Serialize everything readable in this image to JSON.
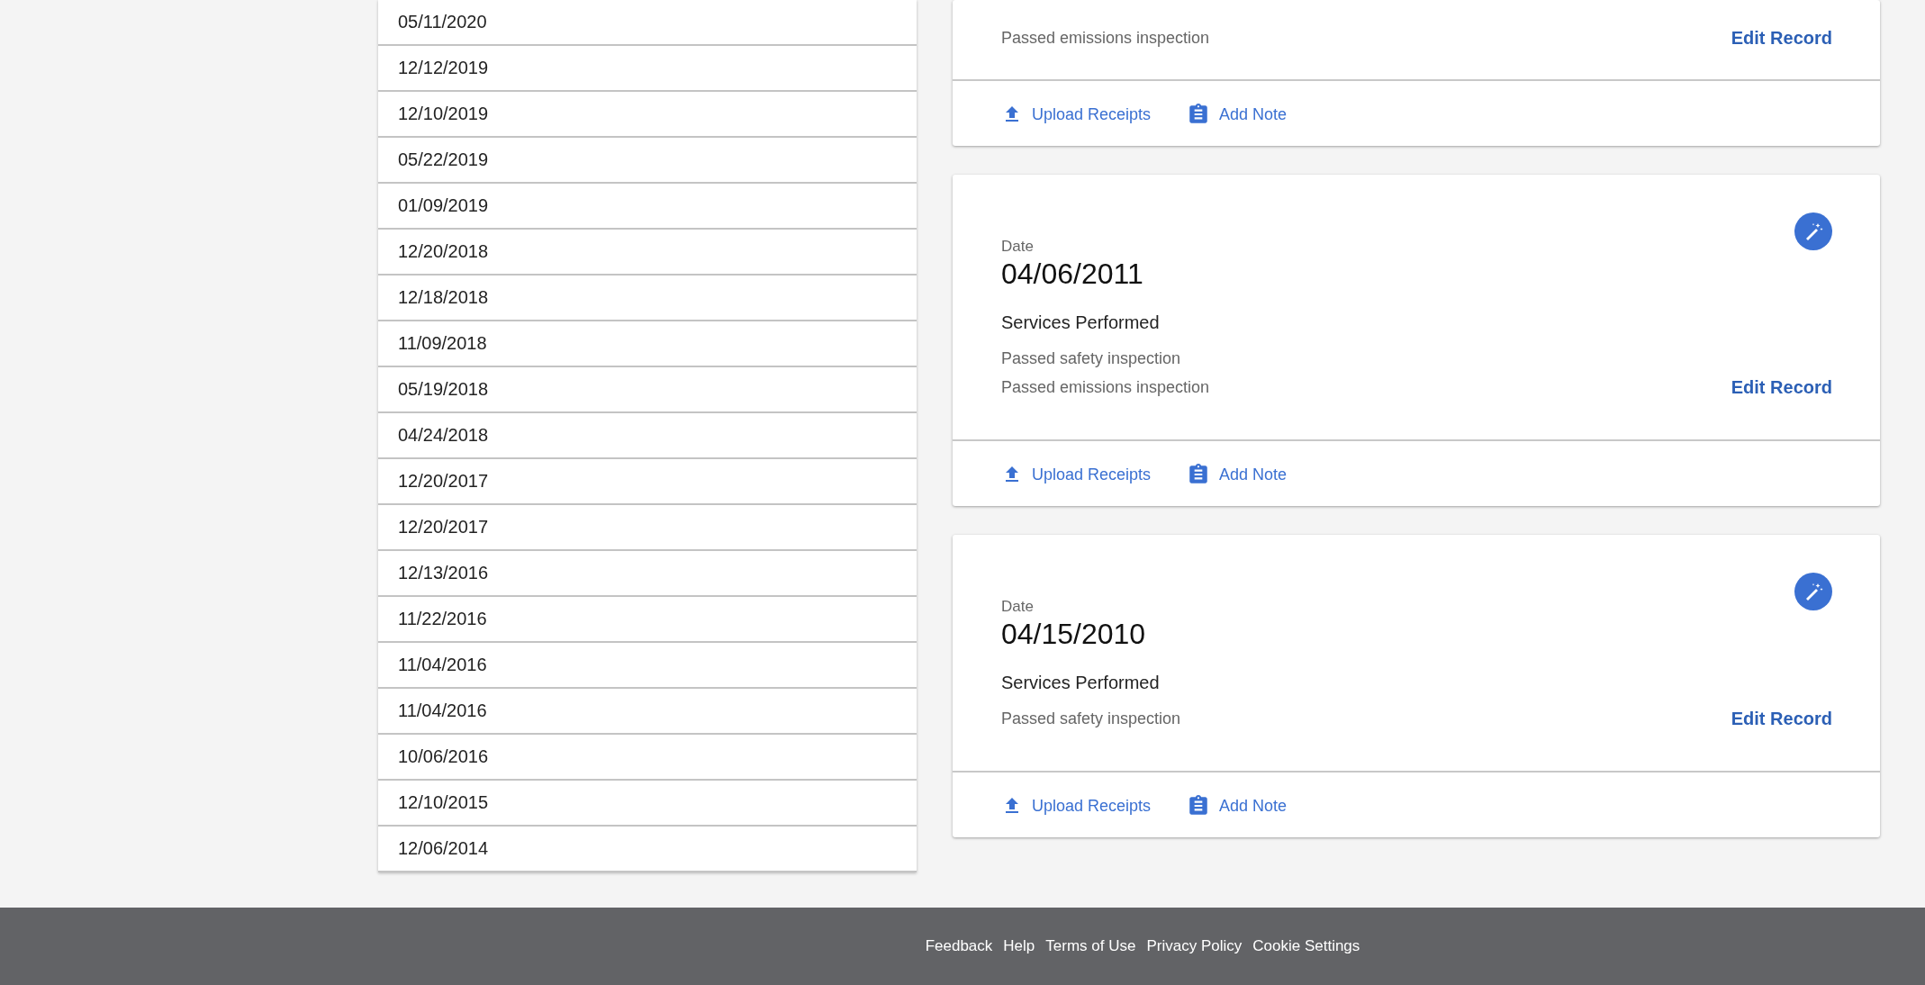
{
  "history_list": [
    "05/11/2020",
    "12/12/2019",
    "12/10/2019",
    "05/22/2019",
    "01/09/2019",
    "12/20/2018",
    "12/18/2018",
    "11/09/2018",
    "05/19/2018",
    "04/24/2018",
    "12/20/2017",
    "12/20/2017",
    "12/13/2016",
    "11/22/2016",
    "11/04/2016",
    "11/04/2016",
    "10/06/2016",
    "12/10/2015",
    "12/06/2014"
  ],
  "records": [
    {
      "services": [
        "Passed emissions inspection"
      ],
      "edit_link": "Edit Record",
      "actions": [
        "Upload Receipts",
        "Add Note"
      ]
    },
    {
      "date_label": "Date",
      "date": "04/06/2011",
      "services_heading": "Services Performed",
      "services": [
        "Passed safety inspection",
        "Passed emissions inspection"
      ],
      "edit_link": "Edit Record",
      "actions": [
        "Upload Receipts",
        "Add Note"
      ]
    },
    {
      "date_label": "Date",
      "date": "04/15/2010",
      "services_heading": "Services Performed",
      "services": [
        "Passed safety inspection"
      ],
      "edit_link": "Edit Record",
      "actions": [
        "Upload Receipts",
        "Add Note"
      ]
    }
  ],
  "footer": {
    "links": [
      "Feedback",
      "Help",
      "Terms of Use",
      "Privacy Policy",
      "Cookie Settings"
    ]
  }
}
